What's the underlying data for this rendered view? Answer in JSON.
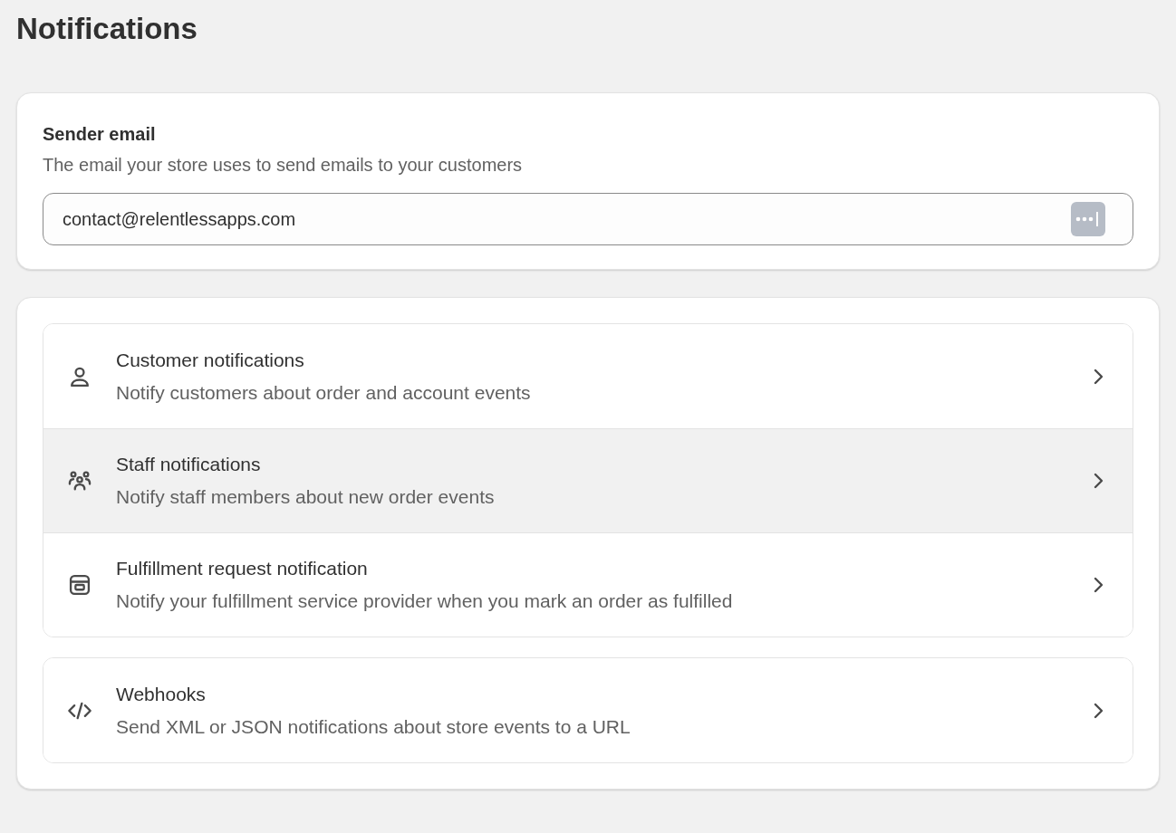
{
  "page_title": "Notifications",
  "sender_email": {
    "title": "Sender email",
    "description": "The email your store uses to send emails to your customers",
    "value": "contact@relentlessapps.com"
  },
  "groups": [
    {
      "items": [
        {
          "kind": "person",
          "title": "Customer notifications",
          "description": "Notify customers about order and account events",
          "highlighted": false
        },
        {
          "kind": "people",
          "title": "Staff notifications",
          "description": "Notify staff members about new order events",
          "highlighted": true
        },
        {
          "kind": "box",
          "title": "Fulfillment request notification",
          "description": "Notify your fulfillment service provider when you mark an order as fulfilled",
          "highlighted": false
        }
      ]
    },
    {
      "items": [
        {
          "kind": "code",
          "title": "Webhooks",
          "description": "Send XML or JSON notifications about store events to a URL",
          "highlighted": false
        }
      ]
    }
  ]
}
